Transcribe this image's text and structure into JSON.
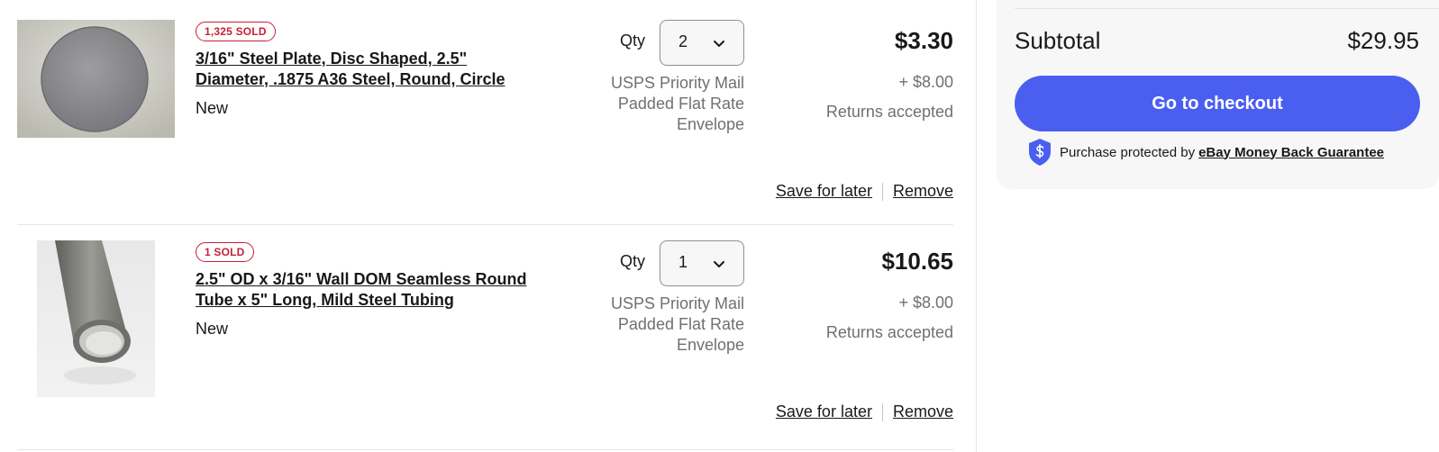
{
  "items": [
    {
      "sold_badge": "1,325 SOLD",
      "title_line1": "3/16\" Steel Plate, Disc Shaped, 2.5\"",
      "title_line2": "Diameter, .1875 A36 Steel, Round, Circle",
      "condition": "New",
      "qty_label": "Qty",
      "qty_value": "2",
      "shipping_line1": "USPS Priority Mail",
      "shipping_line2": "Padded Flat Rate",
      "shipping_line3": "Envelope",
      "price": "$3.30",
      "shipping_cost": "+ $8.00",
      "returns": "Returns accepted",
      "save_for_later": "Save for later",
      "remove": "Remove",
      "image_icon": "steel-disc-image"
    },
    {
      "sold_badge": "1 SOLD",
      "title_line1": "2.5\" OD x 3/16\" Wall DOM Seamless Round",
      "title_line2": "Tube x 5\" Long, Mild Steel Tubing",
      "condition": "New",
      "qty_label": "Qty",
      "qty_value": "1",
      "shipping_line1": "USPS Priority Mail",
      "shipping_line2": "Padded Flat Rate",
      "shipping_line3": "Envelope",
      "price": "$10.65",
      "shipping_cost": "+ $8.00",
      "returns": "Returns accepted",
      "save_for_later": "Save for later",
      "remove": "Remove",
      "image_icon": "steel-tube-image"
    }
  ],
  "summary": {
    "subtotal_label": "Subtotal",
    "subtotal_value": "$29.95",
    "checkout_label": "Go to checkout",
    "protection_text": "Purchase protected by",
    "protection_link": "eBay Money Back Guarantee"
  },
  "colors": {
    "checkout_button": "#4a5ff0",
    "sold_badge": "#c71f37",
    "shield": "#4a5ff0"
  }
}
